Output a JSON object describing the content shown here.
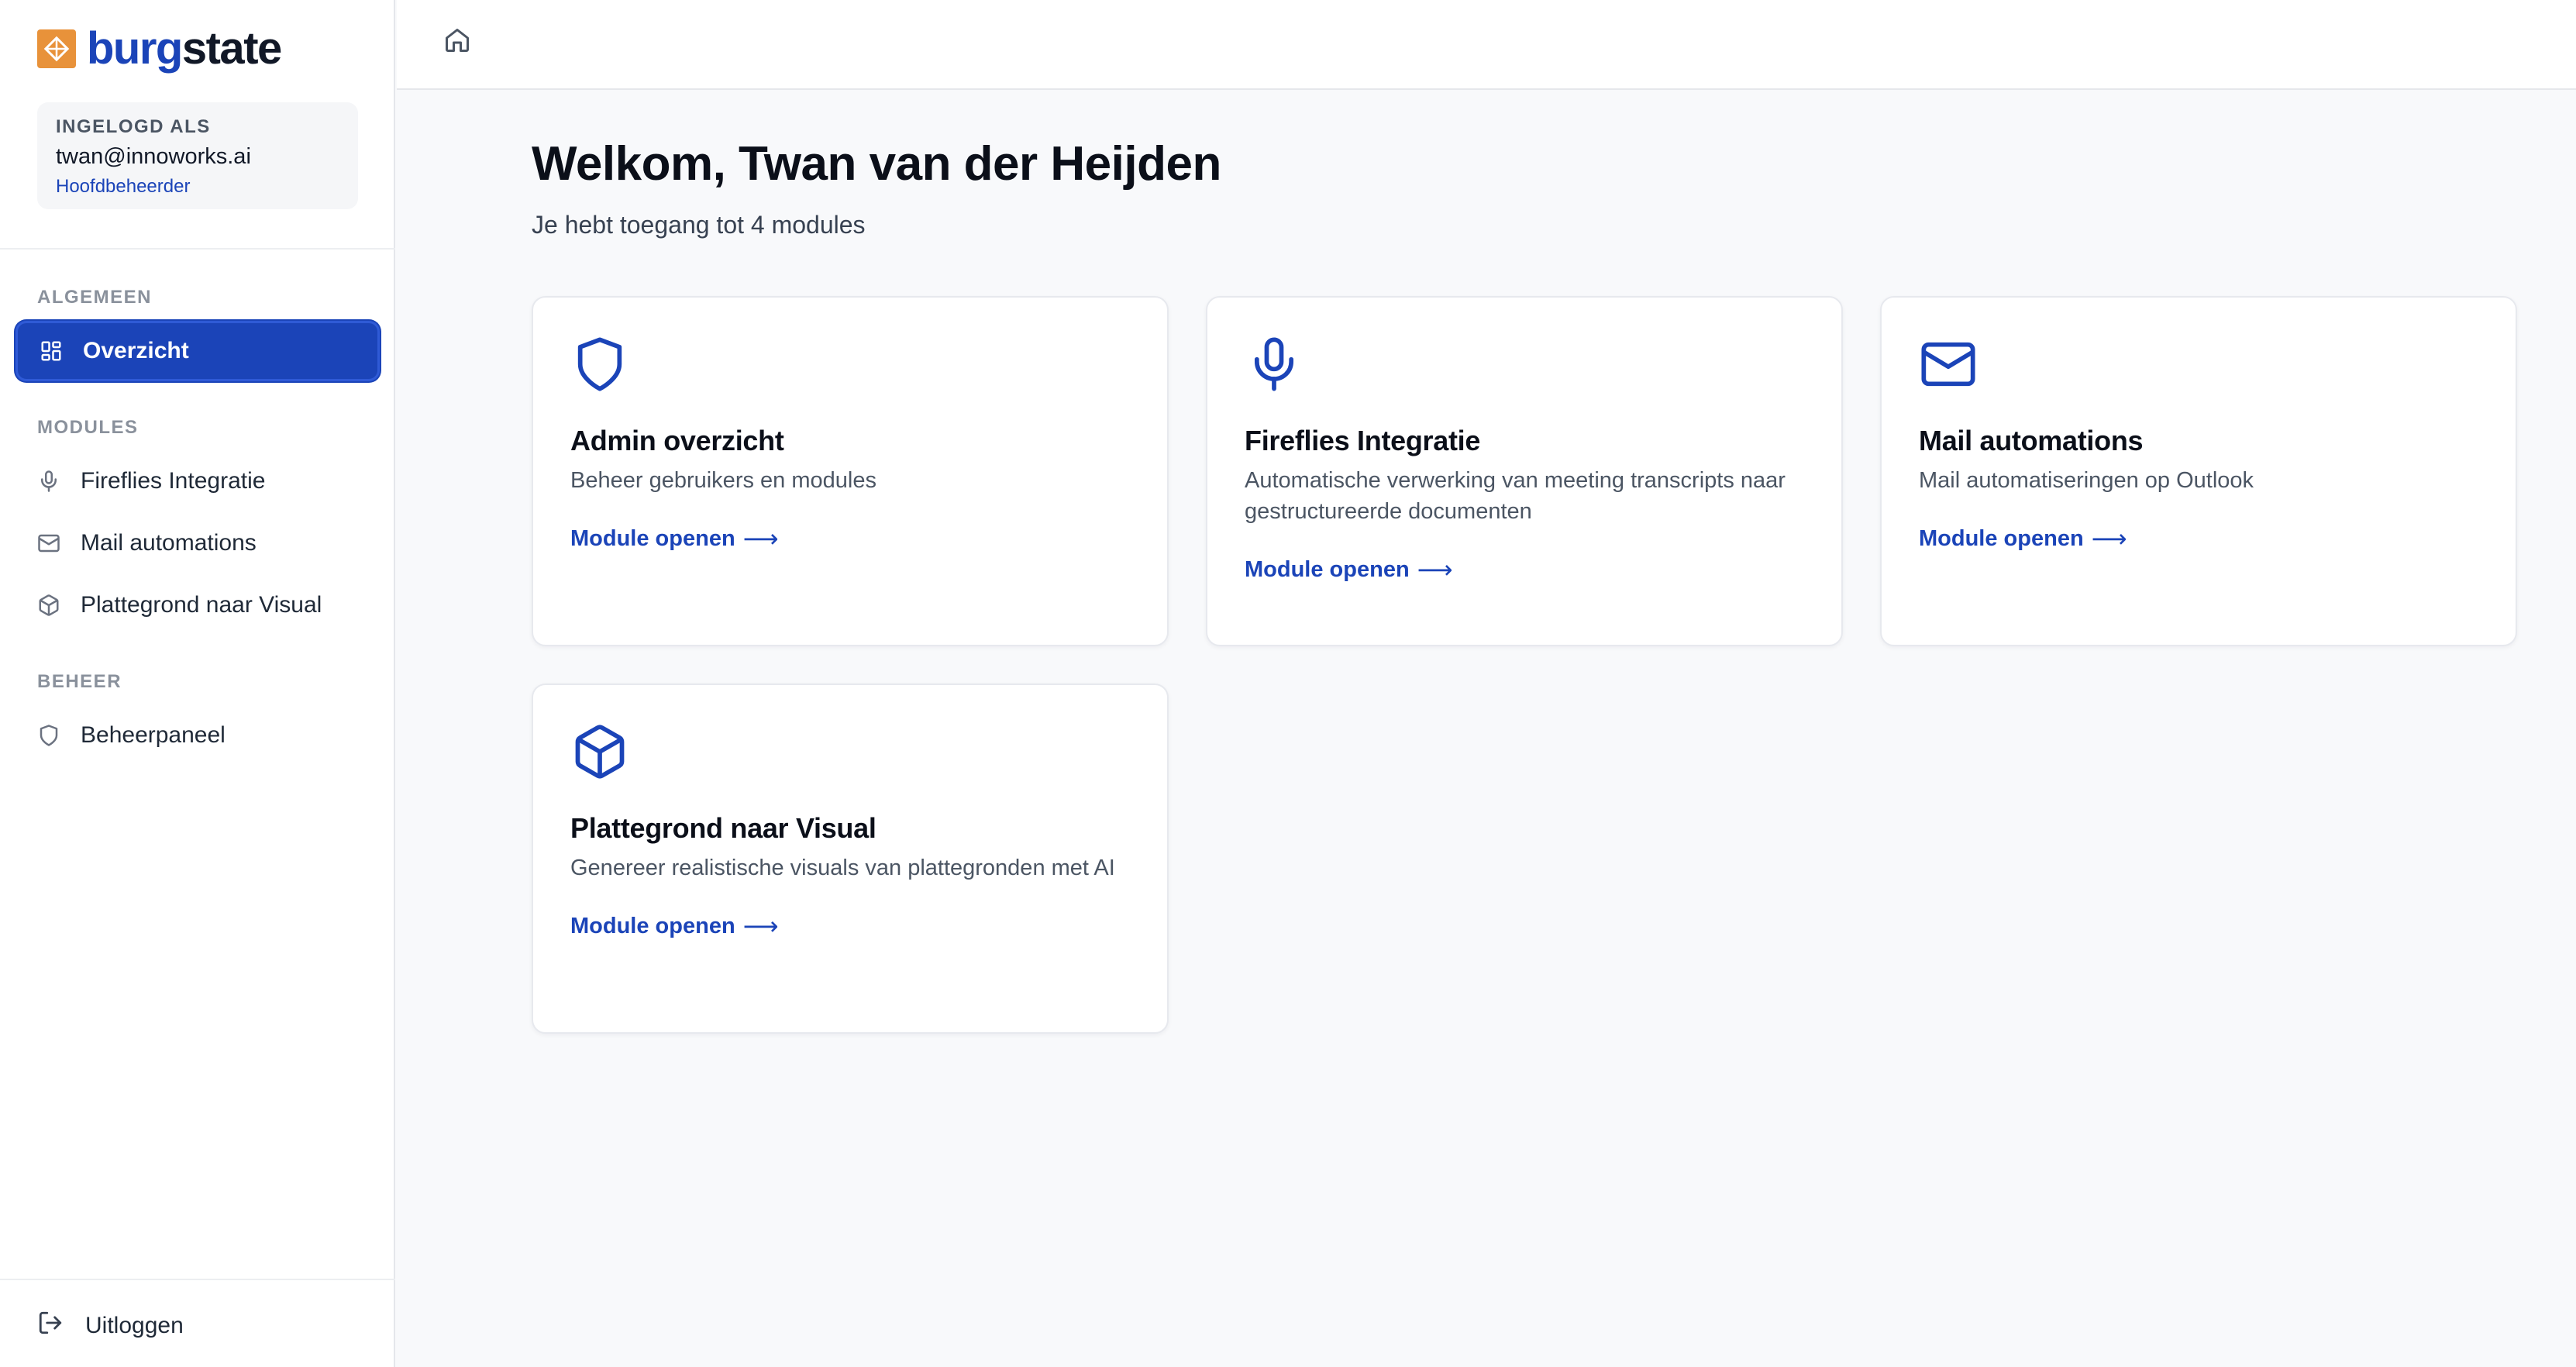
{
  "brand": {
    "name_part1": "burg",
    "name_part2": "state",
    "color": "#1b44b8",
    "mark_color": "#e8923a"
  },
  "user": {
    "caption": "INGELOGD ALS",
    "email": "twan@innoworks.ai",
    "role": "Hoofdbeheerder"
  },
  "sidebar": {
    "sections": [
      {
        "label": "ALGEMEEN"
      },
      {
        "label": "MODULES"
      },
      {
        "label": "BEHEER"
      }
    ],
    "items": [
      {
        "label": "Overzicht",
        "icon": "grid-icon",
        "active": true
      },
      {
        "label": "Fireflies Integratie",
        "icon": "microphone-icon"
      },
      {
        "label": "Mail automations",
        "icon": "mail-icon"
      },
      {
        "label": "Plattegrond naar Visual",
        "icon": "cube-icon"
      },
      {
        "label": "Beheerpaneel",
        "icon": "shield-icon"
      }
    ],
    "logout_label": "Uitloggen"
  },
  "topbar": {
    "home_icon": "home-icon"
  },
  "main": {
    "title": "Welkom, Twan van der Heijden",
    "subtitle": "Je hebt toegang tot 4 modules",
    "cards": [
      {
        "title": "Admin overzicht",
        "description": "Beheer gebruikers en modules",
        "link": "Module openen",
        "icon": "shield-icon"
      },
      {
        "title": "Fireflies Integratie",
        "description": "Automatische verwerking van meeting transcripts naar gestructureerde documenten",
        "link": "Module openen",
        "icon": "microphone-icon"
      },
      {
        "title": "Mail automations",
        "description": "Mail automatiseringen op Outlook",
        "link": "Module openen",
        "icon": "mail-icon"
      },
      {
        "title": "Plattegrond naar Visual",
        "description": "Genereer realistische visuals van plattegronden met AI",
        "link": "Module openen",
        "icon": "cube-icon"
      }
    ]
  },
  "colors": {
    "accent": "#1b44b8",
    "background": "#f8f9fb",
    "sidebar": "#ffffff"
  }
}
